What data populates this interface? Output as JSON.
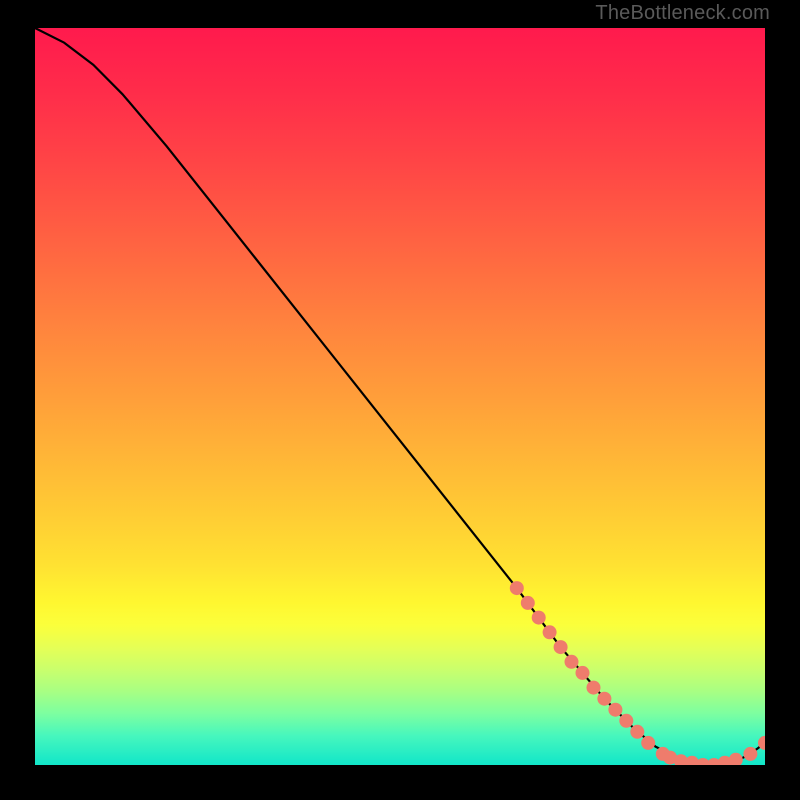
{
  "attribution": "TheBottleneck.com",
  "colors": {
    "curve": "#000000",
    "marker_fill": "#ef7c6c",
    "marker_stroke": "#a84c42",
    "background_black": "#000000"
  },
  "chart_data": {
    "type": "line",
    "title": "",
    "xlabel": "",
    "ylabel": "",
    "xlim": [
      0,
      100
    ],
    "ylim": [
      0,
      100
    ],
    "series": [
      {
        "name": "bottleneck-curve",
        "x": [
          0,
          4,
          8,
          12,
          18,
          26,
          34,
          42,
          50,
          58,
          66,
          72,
          78,
          82,
          85,
          88,
          90,
          92,
          94,
          96,
          98,
          100
        ],
        "y": [
          100,
          98,
          95,
          91,
          84,
          74,
          64,
          54,
          44,
          34,
          24,
          16,
          9,
          5,
          2.5,
          1,
          0.5,
          0,
          0,
          0.5,
          1.5,
          3
        ]
      }
    ],
    "markers": [
      {
        "x": 66,
        "y": 24
      },
      {
        "x": 67.5,
        "y": 22
      },
      {
        "x": 69,
        "y": 20
      },
      {
        "x": 70.5,
        "y": 18
      },
      {
        "x": 72,
        "y": 16
      },
      {
        "x": 73.5,
        "y": 14
      },
      {
        "x": 75,
        "y": 12.5
      },
      {
        "x": 76.5,
        "y": 10.5
      },
      {
        "x": 78,
        "y": 9
      },
      {
        "x": 79.5,
        "y": 7.5
      },
      {
        "x": 81,
        "y": 6
      },
      {
        "x": 82.5,
        "y": 4.5
      },
      {
        "x": 84,
        "y": 3
      },
      {
        "x": 86,
        "y": 1.5
      },
      {
        "x": 87,
        "y": 1
      },
      {
        "x": 88.5,
        "y": 0.5
      },
      {
        "x": 90,
        "y": 0.3
      },
      {
        "x": 91.5,
        "y": 0
      },
      {
        "x": 93,
        "y": 0
      },
      {
        "x": 94.5,
        "y": 0.3
      },
      {
        "x": 96,
        "y": 0.7
      },
      {
        "x": 98,
        "y": 1.5
      },
      {
        "x": 100,
        "y": 3
      }
    ]
  }
}
